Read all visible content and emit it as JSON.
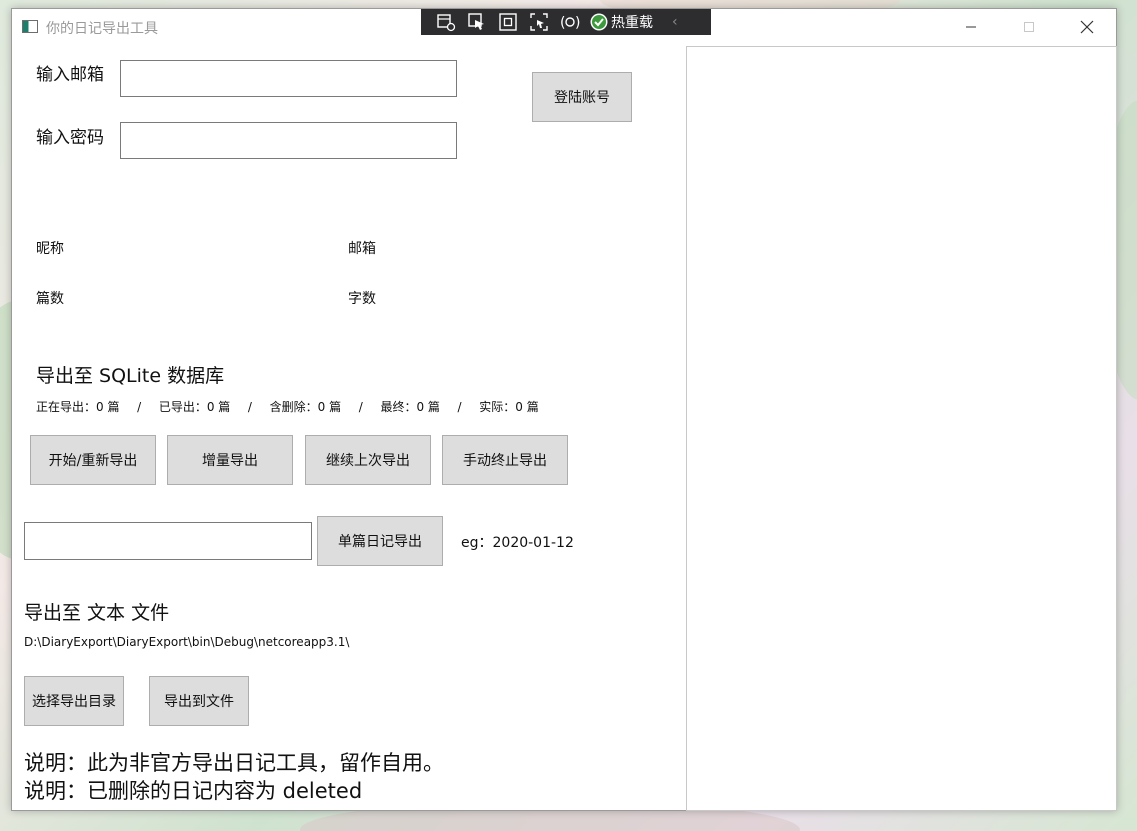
{
  "window": {
    "title": "你的日记导出工具"
  },
  "debug_toolbar": {
    "hot_reload_label": "热重载",
    "icons": [
      "live-visual-tree-icon",
      "select-element-icon",
      "display-layout-adorners-icon",
      "track-focus-icon",
      "xaml-binding-icon",
      "hot-reload-check-icon",
      "collapse-chevron-icon"
    ]
  },
  "login": {
    "email_label": "输入邮箱",
    "email_value": "",
    "password_label": "输入密码",
    "password_value": "",
    "login_button": "登陆账号"
  },
  "account_info": {
    "nickname_label": "昵称",
    "email_label": "邮箱",
    "count_label": "篇数",
    "words_label": "字数"
  },
  "sqlite_export": {
    "heading": "导出至 SQLite 数据库",
    "status": {
      "exporting": "正在导出：0 篇",
      "exported": "已导出：0 篇",
      "deleted": "含删除：0 篇",
      "final": "最终：0 篇",
      "actual": "实际：0 篇",
      "separator": "/"
    },
    "buttons": {
      "start": "开始/重新导出",
      "incremental": "增量导出",
      "resume": "继续上次导出",
      "stop": "手动终止导出"
    }
  },
  "single_export": {
    "date_value": "",
    "button": "单篇日记导出",
    "hint": "eg：2020-01-12"
  },
  "text_export": {
    "heading": "导出至 文本 文件",
    "path": "D:\\DiaryExport\\DiaryExport\\bin\\Debug\\netcoreapp3.1\\",
    "choose_dir_button": "选择导出目录",
    "export_button": "导出到文件"
  },
  "notes": [
    "说明：此为非官方导出日记工具，留作自用。",
    "说明：已删除的日记内容为 deleted"
  ]
}
